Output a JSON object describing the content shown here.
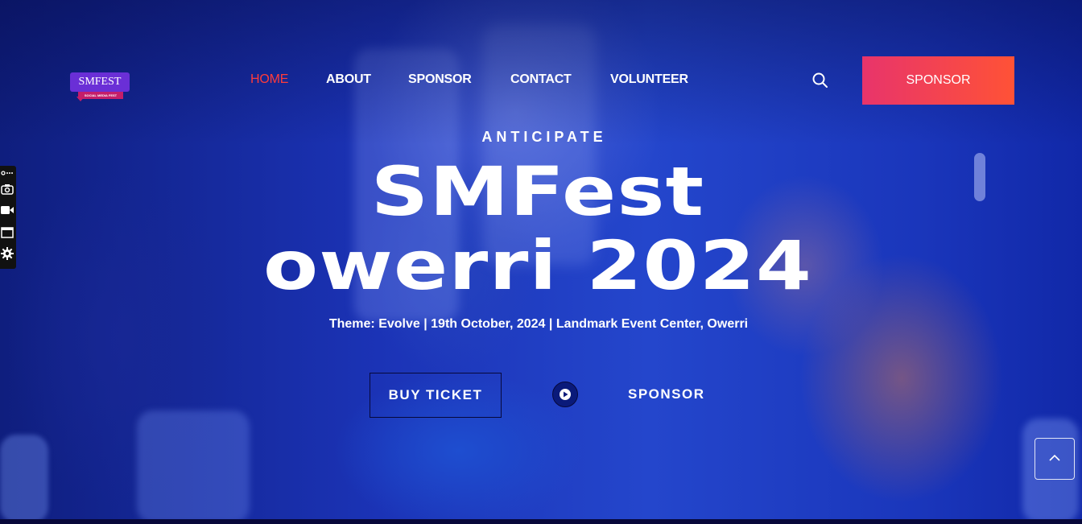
{
  "logo": {
    "main_text": "SMFEST",
    "sub_text": "SOCIAL MEDIA FEST"
  },
  "nav": {
    "items": [
      "HOME",
      "ABOUT",
      "SPONSOR",
      "CONTACT",
      "VOLUNTEER"
    ]
  },
  "header": {
    "sponsor_button_label": "SPONSOR"
  },
  "hero": {
    "kicker": "ANTICIPATE",
    "title_line1": "SMFest",
    "title_line2": "owerri 2024",
    "theme_line": "Theme: Evolve | 19th October, 2024 | Landmark Event Center, Owerri",
    "buy_ticket_label": "BUY TICKET",
    "sponsor_link_label": "SPONSOR"
  },
  "icons": {
    "search": "search-icon",
    "play": "play-icon",
    "scroll_top": "chevron-up-icon",
    "widget": [
      "link-icon",
      "camera-icon",
      "video-icon",
      "window-icon",
      "gear-icon"
    ]
  },
  "colors": {
    "nav_active": "#ff3b3b",
    "sponsor_gradient_start": "#e8346b",
    "sponsor_gradient_end": "#ff5236",
    "logo_purple": "#6a2fd6",
    "logo_magenta": "#c41e6a"
  }
}
